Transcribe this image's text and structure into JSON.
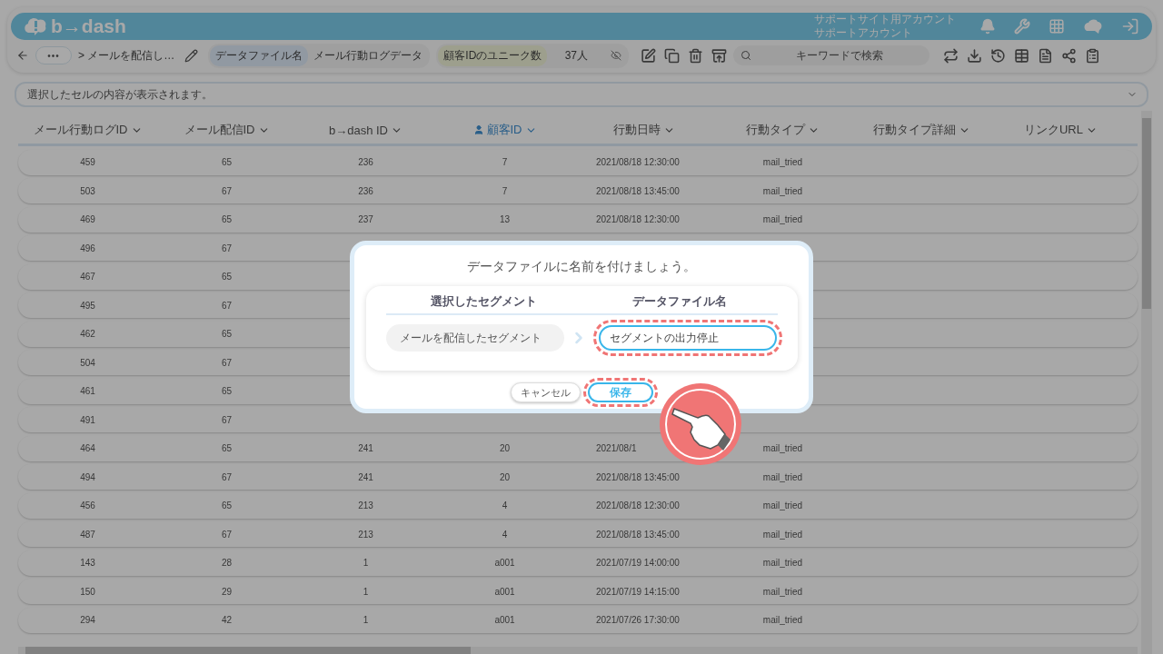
{
  "header": {
    "logo_text": "b→dash",
    "account_lines": [
      "サポートサイト用アカウント",
      "サポートアカウント"
    ]
  },
  "toolbar": {
    "more_button": "•••",
    "breadcrumb": "> メールを配信し…",
    "chips": [
      {
        "label": "データファイル名",
        "value": "メール行動ログデータ",
        "kind": "name"
      },
      {
        "label": "顧客IDのユニーク数",
        "value": "37人",
        "kind": "count"
      }
    ],
    "search": {
      "placeholder": "キーワードで検索"
    }
  },
  "cell_viewer": {
    "placeholder": "選択したセルの内容が表示されます。"
  },
  "table": {
    "columns": [
      {
        "label": "メール行動ログID",
        "selected": false
      },
      {
        "label": "メール配信ID",
        "selected": false
      },
      {
        "label": "b→dash ID",
        "selected": false
      },
      {
        "label": "顧客ID",
        "selected": true
      },
      {
        "label": "行動日時",
        "selected": false
      },
      {
        "label": "行動タイプ",
        "selected": false
      },
      {
        "label": "行動タイプ詳細",
        "selected": false
      },
      {
        "label": "リンクURL",
        "selected": false
      }
    ],
    "rows": [
      [
        "459",
        "65",
        "236",
        "7",
        "2021/08/18 12:30:00",
        "mail_tried"
      ],
      [
        "503",
        "67",
        "236",
        "7",
        "2021/08/18 13:45:00",
        "mail_tried"
      ],
      [
        "469",
        "65",
        "237",
        "13",
        "2021/08/18 12:30:00",
        "mail_tried"
      ],
      [
        "496",
        "67",
        null,
        null,
        null,
        null
      ],
      [
        "467",
        "65",
        null,
        null,
        null,
        null
      ],
      [
        "495",
        "67",
        null,
        null,
        null,
        null
      ],
      [
        "462",
        "65",
        null,
        null,
        null,
        null
      ],
      [
        "504",
        "67",
        null,
        null,
        null,
        null
      ],
      [
        "461",
        "65",
        null,
        null,
        null,
        null
      ],
      [
        "491",
        "67",
        null,
        null,
        null,
        null
      ],
      [
        "464",
        "65",
        "241",
        "20",
        "2021/08/1",
        "mail_tried"
      ],
      [
        "494",
        "67",
        "241",
        "20",
        "2021/08/18 13:45:00",
        "mail_tried"
      ],
      [
        "456",
        "65",
        "213",
        "4",
        "2021/08/18 12:30:00",
        "mail_tried"
      ],
      [
        "487",
        "67",
        "213",
        "4",
        "2021/08/18 13:45:00",
        "mail_tried"
      ],
      [
        "143",
        "28",
        "1",
        "a001",
        "2021/07/19 14:00:00",
        "mail_tried"
      ],
      [
        "150",
        "29",
        "1",
        "a001",
        "2021/07/19 14:15:00",
        "mail_tried"
      ],
      [
        "294",
        "42",
        "1",
        "a001",
        "2021/07/26 17:30:00",
        "mail_tried"
      ]
    ]
  },
  "dialog": {
    "title": "データファイルに名前を付けましょう。",
    "column_headers": [
      "選択したセグメント",
      "データファイル名"
    ],
    "segment": "メールを配信したセグメント",
    "file_name": {
      "value": "セグメントの出力停止"
    },
    "buttons": [
      {
        "label": "キャンセル",
        "kind": "cancel"
      },
      {
        "label": "保存",
        "kind": "save"
      }
    ]
  }
}
